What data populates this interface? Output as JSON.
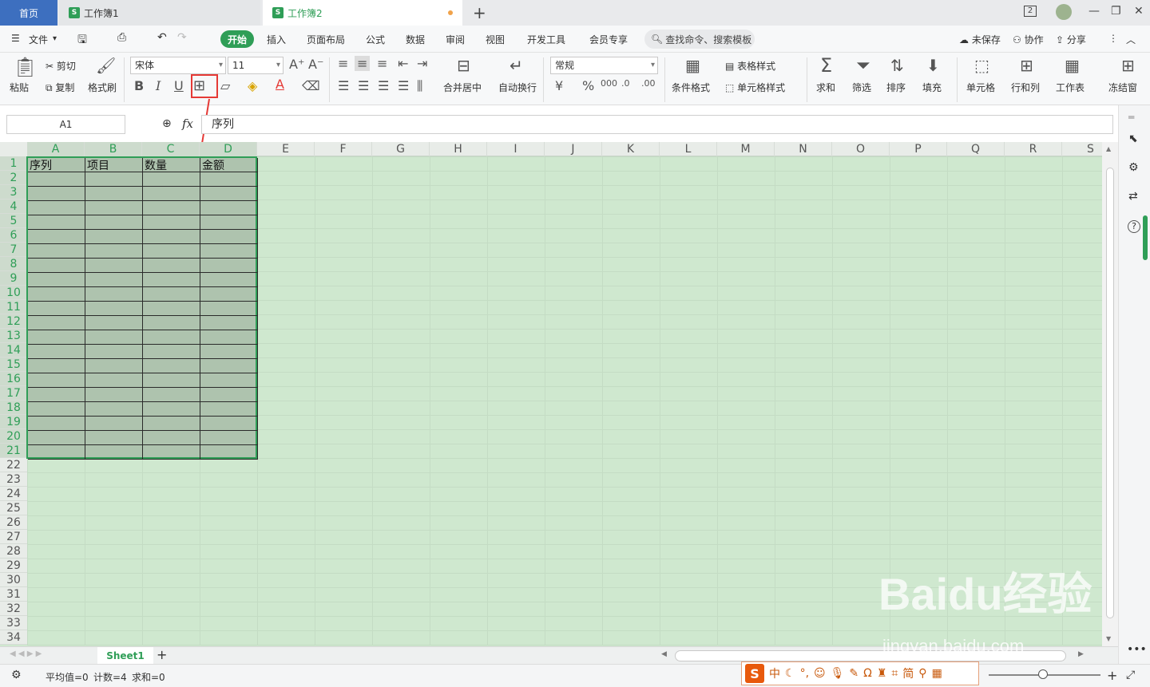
{
  "titlebar": {
    "home_label": "首页",
    "tabs": [
      {
        "label": "工作簿1",
        "icon": "S"
      },
      {
        "label": "工作簿2",
        "icon": "S"
      }
    ],
    "window_count": "2"
  },
  "menu": {
    "file": "文件",
    "start": "开始",
    "items": [
      "插入",
      "页面布局",
      "公式",
      "数据",
      "审阅",
      "视图",
      "开发工具",
      "会员专享"
    ],
    "search_placeholder": "查找命令、搜索模板",
    "unsaved": "未保存",
    "collab": "协作",
    "share": "分享"
  },
  "ribbon": {
    "paste": "粘贴",
    "cut": "剪切",
    "copy": "复制",
    "format_painter": "格式刷",
    "font_name": "宋体",
    "font_size": "11",
    "number_format": "常规",
    "merge_center": "合并居中",
    "wrap_text": "自动换行",
    "cond_format": "条件格式",
    "table_style": "表格样式",
    "cell_style": "单元格样式",
    "sum": "求和",
    "filter": "筛选",
    "sort": "排序",
    "fill": "填充",
    "cell": "单元格",
    "row_col": "行和列",
    "worksheet": "工作表",
    "freeze": "冻结窗"
  },
  "formula_bar": {
    "cell_ref": "A1",
    "fx": "fx",
    "value": "序列"
  },
  "grid": {
    "columns": [
      "A",
      "B",
      "C",
      "D",
      "E",
      "F",
      "G",
      "H",
      "I",
      "J",
      "K",
      "L",
      "M",
      "N",
      "O",
      "P",
      "Q",
      "R",
      "S"
    ],
    "rows": [
      "1",
      "2",
      "3",
      "4",
      "5",
      "6",
      "7",
      "8",
      "9",
      "10",
      "11",
      "12",
      "13",
      "14",
      "15",
      "16",
      "17",
      "18",
      "19",
      "20",
      "21",
      "22",
      "23",
      "24",
      "25",
      "26",
      "27",
      "28",
      "29",
      "30",
      "31",
      "32",
      "33",
      "34"
    ],
    "header_cells": [
      "序列",
      "项目",
      "数量",
      "金额"
    ]
  },
  "sheets": {
    "active": "Sheet1"
  },
  "status": {
    "average": "平均值=0",
    "count": "计数=4",
    "sum": "求和=0"
  },
  "ime": {
    "logo": "S",
    "mode": "中",
    "simplified": "简"
  },
  "watermark": {
    "brand": "Baidu经验",
    "url": "jingyan.baidu.com"
  },
  "colors": {
    "accent": "#2f9e57",
    "grid_bg": "#cfe8cf",
    "selection": "#aec3ae",
    "highlight": "#e53935"
  }
}
